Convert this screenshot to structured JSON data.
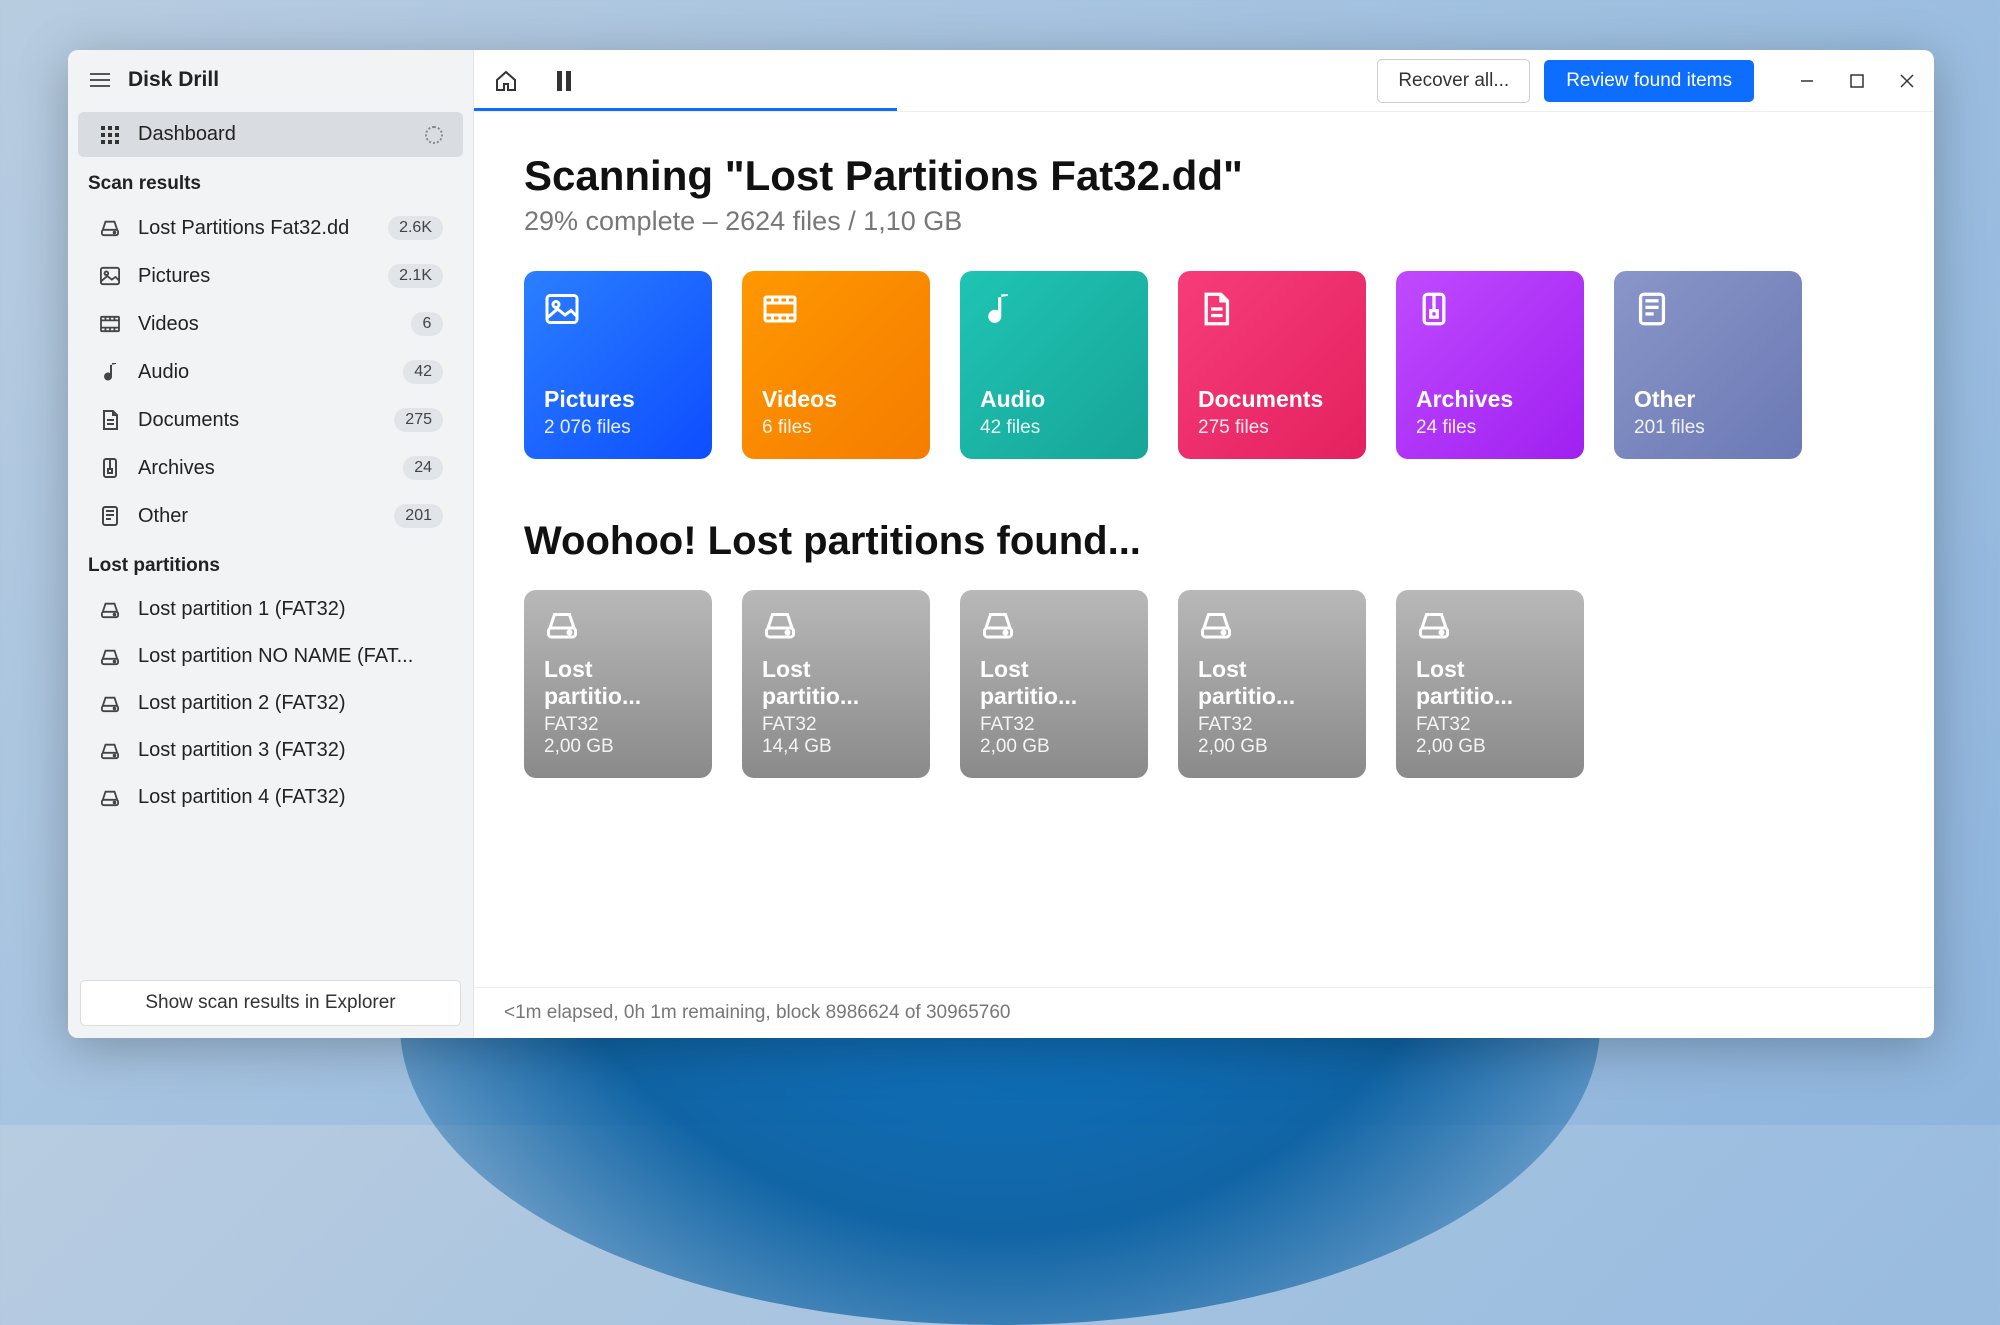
{
  "app": {
    "title": "Disk Drill"
  },
  "sidebar": {
    "dashboard_label": "Dashboard",
    "section_scan": "Scan results",
    "scan_items": [
      {
        "label": "Lost Partitions Fat32.dd",
        "count": "2.6K",
        "icon": "disk"
      },
      {
        "label": "Pictures",
        "count": "2.1K",
        "icon": "image"
      },
      {
        "label": "Videos",
        "count": "6",
        "icon": "video"
      },
      {
        "label": "Audio",
        "count": "42",
        "icon": "audio"
      },
      {
        "label": "Documents",
        "count": "275",
        "icon": "doc"
      },
      {
        "label": "Archives",
        "count": "24",
        "icon": "archive"
      },
      {
        "label": "Other",
        "count": "201",
        "icon": "other"
      }
    ],
    "section_lost": "Lost partitions",
    "lost_items": [
      {
        "label": "Lost partition 1 (FAT32)"
      },
      {
        "label": "Lost partition NO NAME (FAT..."
      },
      {
        "label": "Lost partition 2 (FAT32)"
      },
      {
        "label": "Lost partition 3 (FAT32)"
      },
      {
        "label": "Lost partition 4 (FAT32)"
      }
    ],
    "footer_btn": "Show scan results in Explorer"
  },
  "toolbar": {
    "recover_btn": "Recover all...",
    "review_btn": "Review found items"
  },
  "scan": {
    "title": "Scanning \"Lost Partitions Fat32.dd\"",
    "subtitle": "29% complete – 2624 files / 1,10 GB",
    "progress_percent": 29
  },
  "tiles": [
    {
      "title": "Pictures",
      "sub": "2 076 files",
      "class": "tile-pictures",
      "icon": "image"
    },
    {
      "title": "Videos",
      "sub": "6 files",
      "class": "tile-videos",
      "icon": "video"
    },
    {
      "title": "Audio",
      "sub": "42 files",
      "class": "tile-audio",
      "icon": "audio"
    },
    {
      "title": "Documents",
      "sub": "275 files",
      "class": "tile-documents",
      "icon": "doc"
    },
    {
      "title": "Archives",
      "sub": "24 files",
      "class": "tile-archives",
      "icon": "archive"
    },
    {
      "title": "Other",
      "sub": "201 files",
      "class": "tile-other",
      "icon": "other"
    }
  ],
  "lost_heading": "Woohoo! Lost partitions found...",
  "partitions": [
    {
      "title": "Lost partitio...",
      "fs": "FAT32",
      "size": "2,00 GB"
    },
    {
      "title": "Lost partitio...",
      "fs": "FAT32",
      "size": "14,4 GB"
    },
    {
      "title": "Lost partitio...",
      "fs": "FAT32",
      "size": "2,00 GB"
    },
    {
      "title": "Lost partitio...",
      "fs": "FAT32",
      "size": "2,00 GB"
    },
    {
      "title": "Lost partitio...",
      "fs": "FAT32",
      "size": "2,00 GB"
    }
  ],
  "status": "<1m elapsed, 0h 1m remaining, block 8986624 of 30965760"
}
